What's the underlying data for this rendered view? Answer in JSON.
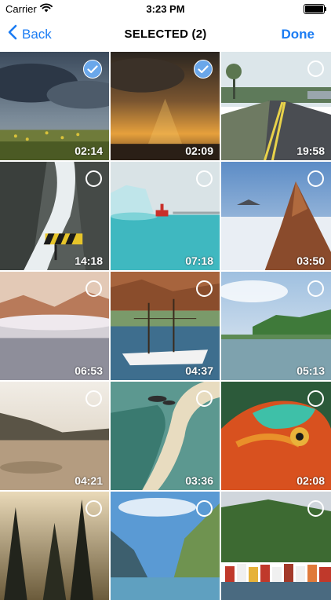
{
  "status": {
    "carrier": "Carrier",
    "time": "3:23 PM"
  },
  "nav": {
    "back_label": "Back",
    "title": "SELECTED (2)",
    "done_label": "Done"
  },
  "colors": {
    "accent": "#1b7cf3",
    "check_fill": "#6aa7ea"
  },
  "videos": [
    {
      "duration": "02:14",
      "selected": true,
      "scene": "meadow-storm-clouds"
    },
    {
      "duration": "02:09",
      "selected": true,
      "scene": "sunset-clouds"
    },
    {
      "duration": "19:58",
      "selected": false,
      "scene": "highway-drive"
    },
    {
      "duration": "14:18",
      "selected": false,
      "scene": "waterfall-rocks"
    },
    {
      "duration": "07:18",
      "selected": false,
      "scene": "iceberg-boat"
    },
    {
      "duration": "03:50",
      "selected": false,
      "scene": "mountain-above-clouds"
    },
    {
      "duration": "06:53",
      "selected": false,
      "scene": "mountain-fog-lake"
    },
    {
      "duration": "04:37",
      "selected": false,
      "scene": "sailboat"
    },
    {
      "duration": "05:13",
      "selected": false,
      "scene": "coastal-island"
    },
    {
      "duration": "04:21",
      "selected": false,
      "scene": "beach-hills-sunset"
    },
    {
      "duration": "03:36",
      "selected": false,
      "scene": "skydiver-coast"
    },
    {
      "duration": "02:08",
      "selected": false,
      "scene": "chameleon"
    },
    {
      "duration": "",
      "selected": false,
      "scene": "pine-trees-sunset"
    },
    {
      "duration": "",
      "selected": false,
      "scene": "fjord-cliffs"
    },
    {
      "duration": "",
      "selected": false,
      "scene": "harbor-town"
    }
  ]
}
